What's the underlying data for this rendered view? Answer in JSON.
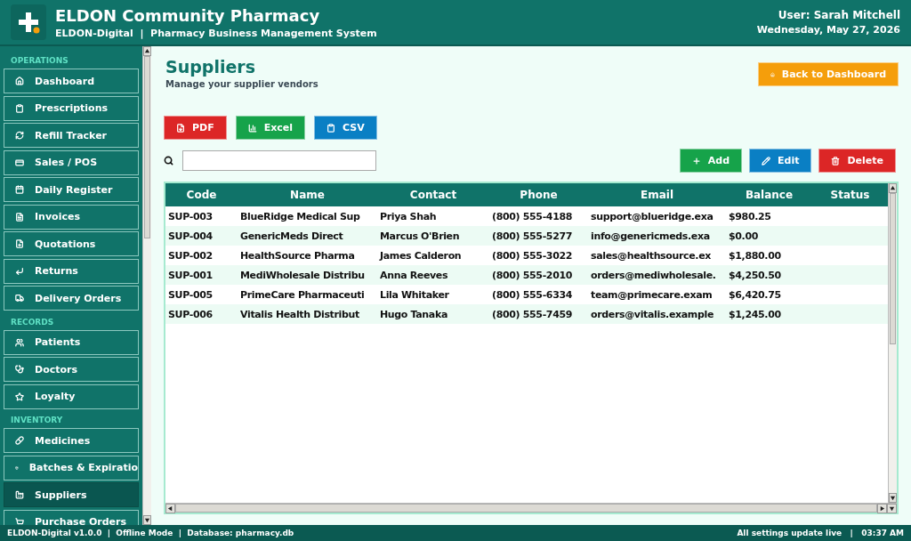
{
  "header": {
    "title": "ELDON Community Pharmacy",
    "subtitle": "ELDON-Digital  |  Pharmacy Business Management System",
    "user": "User: Sarah Mitchell",
    "date": "Wednesday, May 27, 2026"
  },
  "sidebar": {
    "sections": [
      {
        "title": "OPERATIONS",
        "items": [
          {
            "label": "Dashboard",
            "selected": false
          },
          {
            "label": "Prescriptions",
            "selected": false
          },
          {
            "label": "Refill Tracker",
            "selected": false
          },
          {
            "label": "Sales / POS",
            "selected": false
          },
          {
            "label": "Daily Register",
            "selected": false
          },
          {
            "label": "Invoices",
            "selected": false
          },
          {
            "label": "Quotations",
            "selected": false
          },
          {
            "label": "Returns",
            "selected": false
          },
          {
            "label": "Delivery Orders",
            "selected": false
          }
        ]
      },
      {
        "title": "RECORDS",
        "items": [
          {
            "label": "Patients",
            "selected": false
          },
          {
            "label": "Doctors",
            "selected": false
          },
          {
            "label": "Loyalty",
            "selected": false
          }
        ]
      },
      {
        "title": "INVENTORY",
        "items": [
          {
            "label": "Medicines",
            "selected": false
          },
          {
            "label": "Batches & Expiratio",
            "selected": false
          },
          {
            "label": "Suppliers",
            "selected": true
          },
          {
            "label": "Purchase Orders",
            "selected": false
          }
        ]
      }
    ]
  },
  "page": {
    "title": "Suppliers",
    "subtitle": "Manage your supplier vendors",
    "back_button": "Back to Dashboard"
  },
  "export_buttons": [
    "PDF",
    "Excel",
    "CSV"
  ],
  "actions": [
    "Add",
    "Edit",
    "Delete"
  ],
  "table": {
    "columns": [
      "Code",
      "Name",
      "Contact",
      "Phone",
      "Email",
      "Balance",
      "Status"
    ],
    "rows": [
      [
        "SUP-003",
        "BlueRidge Medical Sup",
        "Priya Shah",
        "(800) 555-4188",
        "support@blueridge.exa",
        "$980.25"
      ],
      [
        "SUP-004",
        "GenericMeds Direct",
        "Marcus O'Brien",
        "(800) 555-5277",
        "info@genericmeds.exa",
        "$0.00"
      ],
      [
        "SUP-002",
        "HealthSource Pharma",
        "James Calderon",
        "(800) 555-3022",
        "sales@healthsource.ex",
        "$1,880.00"
      ],
      [
        "SUP-001",
        "MediWholesale Distribu",
        "Anna Reeves",
        "(800) 555-2010",
        "orders@mediwholesale.",
        "$4,250.50"
      ],
      [
        "SUP-005",
        "PrimeCare Pharmaceuti",
        "Lila Whitaker",
        "(800) 555-6334",
        "team@primecare.exam",
        "$6,420.75"
      ],
      [
        "SUP-006",
        "Vitalis Health Distribut",
        "Hugo Tanaka",
        "(800) 555-7459",
        "orders@vitalis.example",
        "$1,245.00"
      ]
    ]
  },
  "status_bar": {
    "left": "ELDON-Digital v1.0.0  |  Offline Mode  |  Database: pharmacy.db",
    "right": "All settings update live   |   03:37 AM"
  }
}
